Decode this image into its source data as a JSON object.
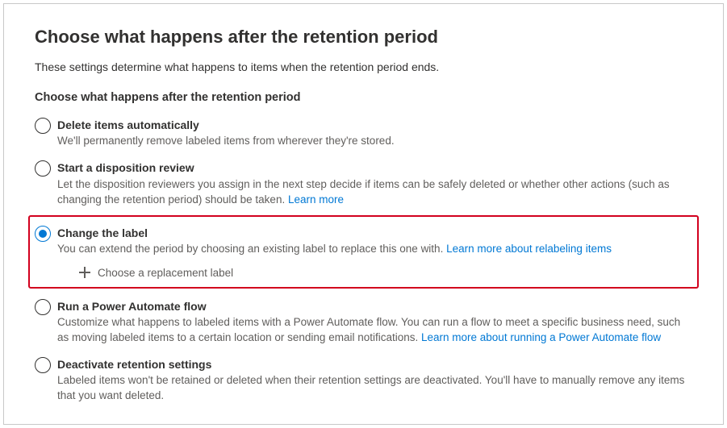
{
  "page": {
    "title": "Choose what happens after the retention period",
    "intro": "These settings determine what happens to items when the retention period ends.",
    "section_heading": "Choose what happens after the retention period"
  },
  "options": {
    "delete": {
      "title": "Delete items automatically",
      "desc": "We'll permanently remove labeled items from wherever they're stored."
    },
    "review": {
      "title": "Start a disposition review",
      "desc": "Let the disposition reviewers you assign in the next step decide if items can be safely deleted or whether other actions (such as changing the retention period) should be taken.  ",
      "link": "Learn more"
    },
    "change": {
      "title": "Change the label",
      "desc": "You can extend the period by choosing an existing label to replace this one with. ",
      "link": "Learn more about relabeling items",
      "action": "Choose a replacement label"
    },
    "flow": {
      "title": "Run a Power Automate flow",
      "desc": "Customize what happens to labeled items with a Power Automate flow. You can run a flow to meet a specific business need, such as moving labeled items to a certain location or sending email notifications. ",
      "link": "Learn more about running a Power Automate flow"
    },
    "deactivate": {
      "title": "Deactivate retention settings",
      "desc": "Labeled items won't be retained or deleted when their retention settings are deactivated. You'll have to manually remove any items that you want deleted."
    }
  }
}
